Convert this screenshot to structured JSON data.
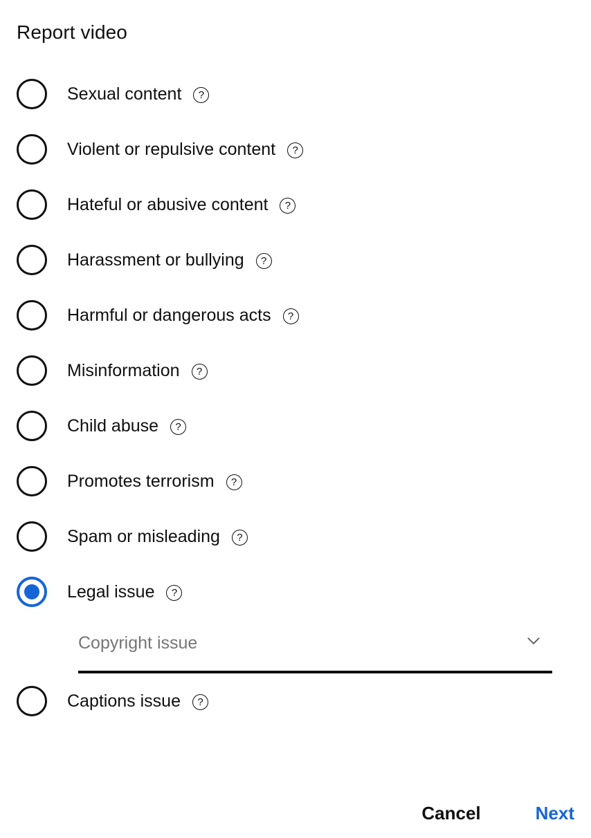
{
  "dialog": {
    "title": "Report video",
    "help_icon_glyph": "?",
    "help_icon_name": "help-icon",
    "accent_color": "#1565d8",
    "text_color": "#0f0f0f",
    "placeholder_color": "#757575",
    "options": [
      {
        "label": "Sexual content",
        "selected": false
      },
      {
        "label": "Violent or repulsive content",
        "selected": false
      },
      {
        "label": "Hateful or abusive content",
        "selected": false
      },
      {
        "label": "Harassment or bullying",
        "selected": false
      },
      {
        "label": "Harmful or dangerous acts",
        "selected": false
      },
      {
        "label": "Misinformation",
        "selected": false
      },
      {
        "label": "Child abuse",
        "selected": false
      },
      {
        "label": "Promotes terrorism",
        "selected": false
      },
      {
        "label": "Spam or misleading",
        "selected": false
      },
      {
        "label": "Legal issue",
        "selected": true
      },
      {
        "label": "Captions issue",
        "selected": false
      }
    ],
    "legal_sub_select": {
      "value": "Copyright issue",
      "placeholder": "Copyright issue",
      "expanded": false,
      "chevron_icon": "chevron-down-icon"
    },
    "actions": {
      "cancel_label": "Cancel",
      "next_label": "Next"
    }
  }
}
